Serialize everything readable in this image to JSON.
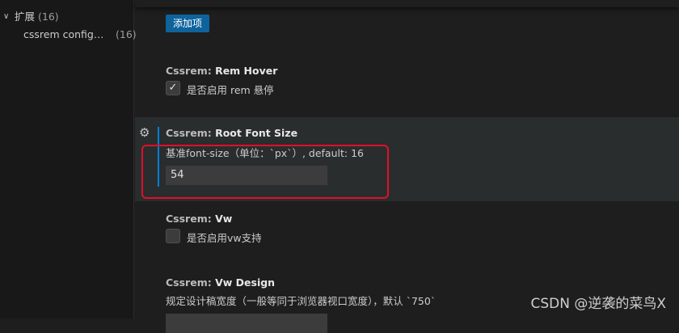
{
  "sidebar": {
    "root": {
      "label": "扩展",
      "count": "(16)"
    },
    "child": {
      "label": "cssrem configur...",
      "count": "(16)"
    }
  },
  "main": {
    "add_item_button": "添加项",
    "settings": [
      {
        "category": "Cssrem: ",
        "name": "Rem Hover",
        "type": "checkbox",
        "checked": true,
        "description": "是否启用 rem 悬停"
      },
      {
        "category": "Cssrem: ",
        "name": "Root Font Size",
        "type": "number",
        "description": "基准font-size（单位：`px`）, default: 16",
        "value": "54"
      },
      {
        "category": "Cssrem: ",
        "name": "Vw",
        "type": "checkbox",
        "checked": false,
        "description": "是否启用vw支持"
      },
      {
        "category": "Cssrem: ",
        "name": "Vw Design",
        "type": "number",
        "description": "规定设计稿宽度（一般等同于浏览器视口宽度），默认 `750`"
      }
    ]
  },
  "icons": {
    "check": "✓",
    "gear": "⚙",
    "chevron": "∨"
  },
  "colors": {
    "accent_button": "#0e639c",
    "focus_bar": "#007fd4",
    "highlight_box": "#e0102b"
  },
  "watermark": "CSDN @逆袭的菜鸟X"
}
